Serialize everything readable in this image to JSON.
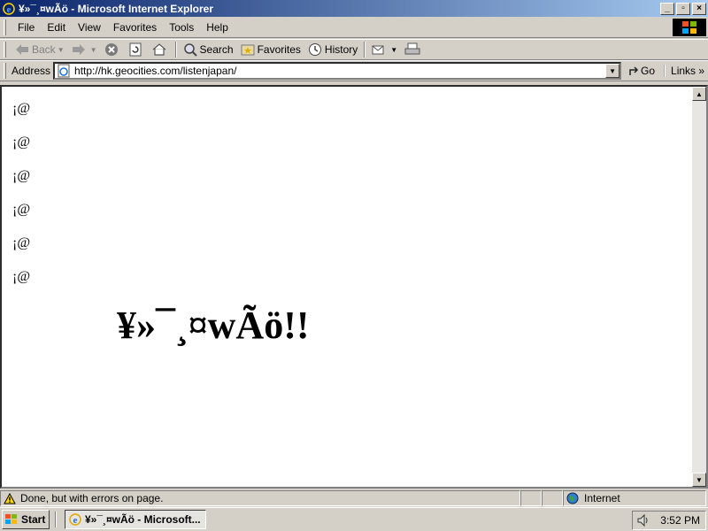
{
  "window": {
    "title": "¥»¯¸¤wÃö - Microsoft Internet Explorer",
    "buttons": [
      "_",
      "▫",
      "×"
    ]
  },
  "menubar": {
    "items": [
      "File",
      "Edit",
      "View",
      "Favorites",
      "Tools",
      "Help"
    ]
  },
  "toolbar": {
    "back_label": "Back",
    "search_label": "Search",
    "favorites_label": "Favorites",
    "history_label": "History"
  },
  "address": {
    "label": "Address",
    "url": "http://hk.geocities.com/listenjapan/",
    "go_label": "Go",
    "links_label": "Links »"
  },
  "page": {
    "lines": [
      "¡@",
      "¡@",
      "¡@",
      "¡@",
      "¡@",
      "¡@"
    ],
    "heading": "¥»¯¸¤wÃö!!"
  },
  "status": {
    "message": "Done, but with errors on page.",
    "zone": "Internet"
  },
  "taskbar": {
    "start_label": "Start",
    "task_label": "¥»¯¸¤wÃö - Microsoft...",
    "clock": "3:52 PM"
  },
  "colors": {
    "title_gradient_start": "#0a246a",
    "title_gradient_end": "#a6caf0",
    "chrome": "#d4d0c8"
  }
}
